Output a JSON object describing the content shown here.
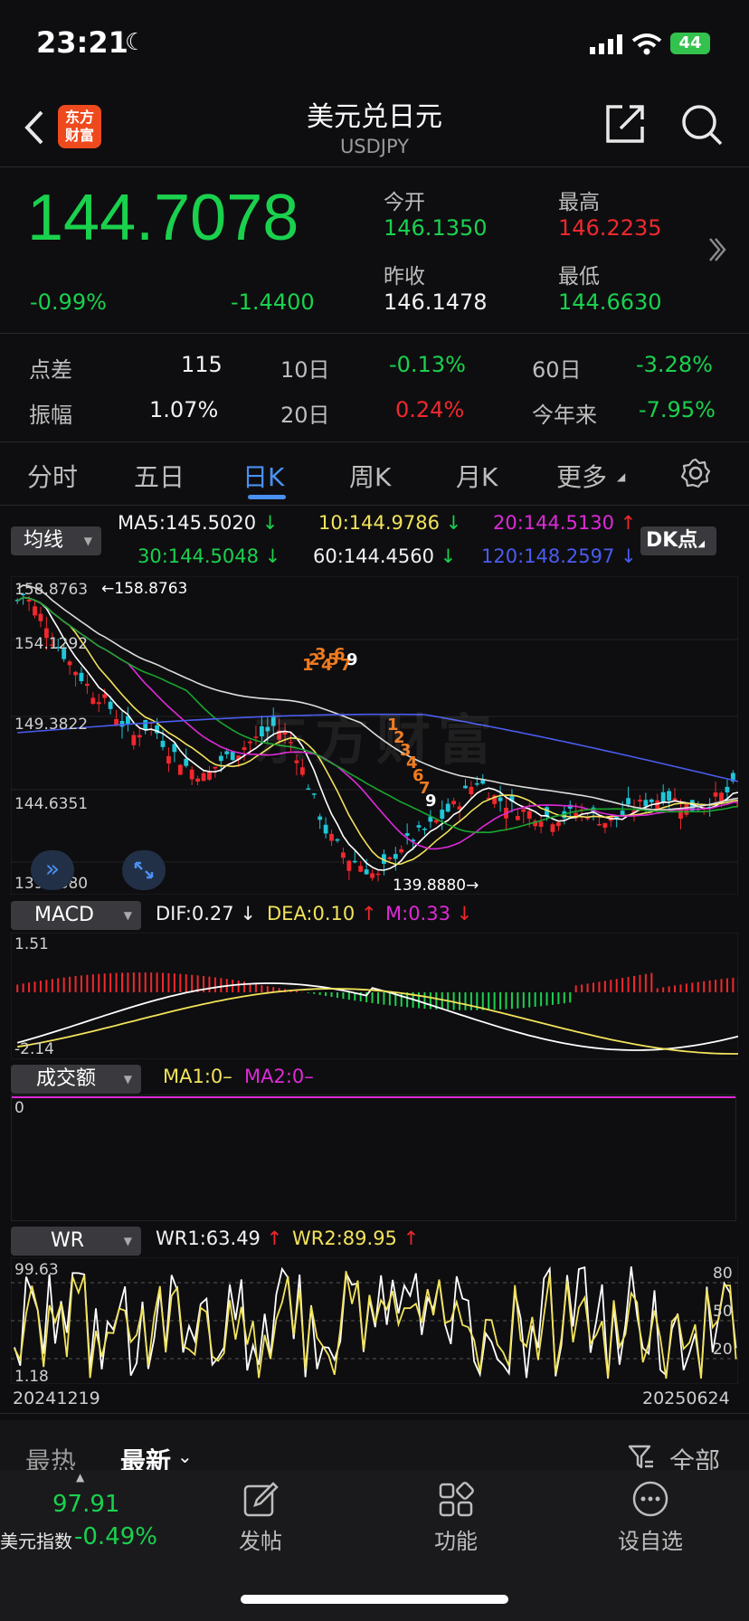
{
  "status_bar": {
    "time": "23:21",
    "battery": "44"
  },
  "header": {
    "title": "美元兑日元",
    "symbol": "USDJPY",
    "logo_text": "东方\n财富"
  },
  "quote": {
    "price": "144.7078",
    "change_pct": "-0.99%",
    "change": "-1.4400",
    "open_label": "今开",
    "open": "146.1350",
    "high_label": "最高",
    "high": "146.2235",
    "prev_close_label": "昨收",
    "prev_close": "146.1478",
    "low_label": "最低",
    "low": "144.6630"
  },
  "stats": [
    {
      "label": "点差",
      "value": "115",
      "color": "white"
    },
    {
      "label": "10日",
      "value": "-0.13%",
      "color": "green"
    },
    {
      "label": "60日",
      "value": "-3.28%",
      "color": "green"
    },
    {
      "label": "振幅",
      "value": "1.07%",
      "color": "white"
    },
    {
      "label": "20日",
      "value": "0.24%",
      "color": "red"
    },
    {
      "label": "今年来",
      "value": "-7.95%",
      "color": "green"
    }
  ],
  "tabs": [
    "分时",
    "五日",
    "日K",
    "周K",
    "月K",
    "更多"
  ],
  "active_tab": "日K",
  "ma_panel": {
    "selector": "均线",
    "dk_button": "DK点",
    "ma5": "MA5:145.5020",
    "ma10": "10:144.9786",
    "ma20": "20:144.5130",
    "ma30": "30:144.5048",
    "ma60": "60:144.4560",
    "ma120": "120:148.2597",
    "y_labels": [
      "158.8763",
      "154.1292",
      "149.3822",
      "144.6351",
      "139.8880"
    ],
    "max_marker": "158.8763",
    "min_marker": "139.8880",
    "watermark": "东方财富",
    "td_marks_top": [
      "1",
      "2",
      "3",
      "4",
      "5",
      "6",
      "7",
      "9"
    ],
    "td_marks_bottom": [
      "1",
      "2",
      "3",
      "4",
      "6",
      "7",
      "9"
    ]
  },
  "macd_panel": {
    "selector": "MACD",
    "dif": "DIF:0.27",
    "dea": "DEA:0.10",
    "m": "M:0.33",
    "y_top": "1.51",
    "y_bottom": "-2.14"
  },
  "volume_panel": {
    "selector": "成交额",
    "ma1": "MA1:0–",
    "ma2": "MA2:0–",
    "y": "0"
  },
  "wr_panel": {
    "selector": "WR",
    "wr1": "WR1:63.49",
    "wr2": "WR2:89.95",
    "y_top": "99.63",
    "y_bottom": "1.18",
    "right_labels": [
      "80",
      "50",
      "20"
    ],
    "date_start": "20241219",
    "date_end": "20250624"
  },
  "news_tabs": {
    "hot": "最热",
    "latest": "最新",
    "filter": "全部"
  },
  "bottom_nav": {
    "index_value": "97.91",
    "index_name": "美元指数",
    "index_change": "-0.49%",
    "post": "发帖",
    "functions": "功能",
    "watchlist": "设自选"
  },
  "colors": {
    "up": "#f0282d",
    "down": "#1ad14e",
    "ma5": "#ffffff",
    "ma10": "#f2e35b",
    "ma20": "#de2ad8",
    "ma30": "#1aa52e",
    "ma60": "#dcdcdc",
    "ma120": "#4a5cf0"
  }
}
